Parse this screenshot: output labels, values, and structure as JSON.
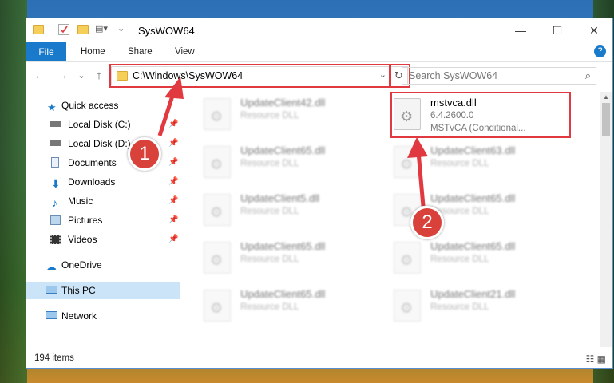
{
  "window": {
    "title": "SysWOW64",
    "controls": {
      "minimize": "—",
      "maximize": "☐",
      "close": "✕"
    }
  },
  "ribbon": {
    "tabs": [
      "File",
      "Home",
      "Share",
      "View"
    ],
    "help": "?"
  },
  "nav": {
    "back": "←",
    "forward": "→",
    "recent": "⌄",
    "up": "↑",
    "address": "C:\\Windows\\SysWOW64",
    "search_placeholder": "Search SysWOW64"
  },
  "sidebar": {
    "items": [
      {
        "label": "Quick access",
        "icon": "star-icon"
      },
      {
        "label": "Local Disk (C:)",
        "icon": "drive-icon",
        "pinned": true
      },
      {
        "label": "Local Disk (D:)",
        "icon": "drive-icon",
        "pinned": true
      },
      {
        "label": "Documents",
        "icon": "documents-icon",
        "pinned": true
      },
      {
        "label": "Downloads",
        "icon": "download-icon",
        "pinned": true
      },
      {
        "label": "Music",
        "icon": "music-icon",
        "pinned": true
      },
      {
        "label": "Pictures",
        "icon": "pictures-icon",
        "pinned": true
      },
      {
        "label": "Videos",
        "icon": "videos-icon",
        "pinned": true
      },
      {
        "label": "OneDrive",
        "icon": "cloud-icon"
      },
      {
        "label": "This PC",
        "icon": "computer-icon",
        "selected": true
      },
      {
        "label": "Network",
        "icon": "network-icon"
      }
    ]
  },
  "files": {
    "left": [
      {
        "name": "UpdateClient42.dll",
        "type": "Resource DLL"
      },
      {
        "name": "UpdateClient65.dll",
        "type": "Resource DLL"
      },
      {
        "name": "UpdateClient5.dll",
        "type": "Resource DLL"
      },
      {
        "name": "UpdateClient65.dll",
        "type": "Resource DLL"
      },
      {
        "name": "UpdateClient65.dll",
        "type": "Resource DLL"
      }
    ],
    "right": [
      {
        "name": "mstvca.dll",
        "version": "6.4.2600.0",
        "desc": "MSTvCA (Conditional..."
      },
      {
        "name": "UpdateClient63.dll",
        "type": "Resource DLL"
      },
      {
        "name": "UpdateClient65.dll",
        "type": "Resource DLL"
      },
      {
        "name": "UpdateClient65.dll",
        "type": "Resource DLL"
      },
      {
        "name": "UpdateClient21.dll",
        "type": "Resource DLL"
      }
    ]
  },
  "status": {
    "items": "194 items"
  },
  "annotations": {
    "step1": "1",
    "step2": "2"
  },
  "colors": {
    "accent": "#1979ca",
    "highlight": "#e0393f",
    "selected": "#cce4f7"
  }
}
